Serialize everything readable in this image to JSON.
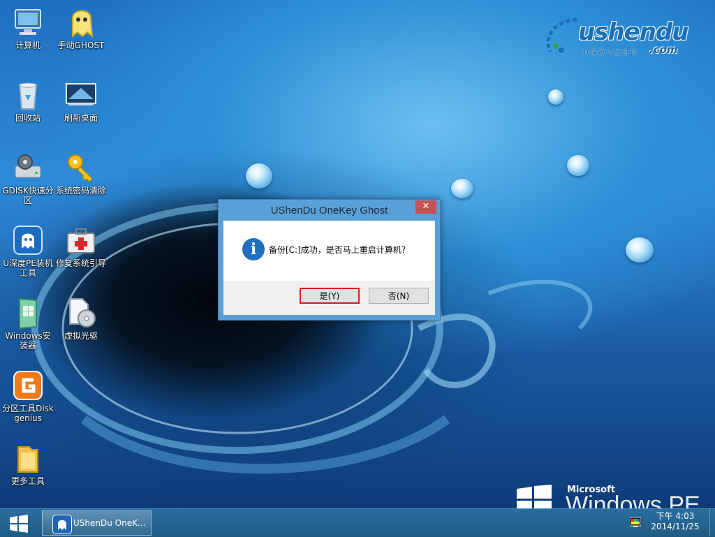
{
  "desktop": {
    "icons": [
      {
        "label": "计算机",
        "icon": "computer-icon"
      },
      {
        "label": "手动GHOST",
        "icon": "ghost-icon"
      },
      {
        "label": "回收站",
        "icon": "recycle-bin-icon"
      },
      {
        "label": "刷新桌面",
        "icon": "monitor-refresh-icon"
      },
      {
        "label": "GDISK快速分区",
        "icon": "disk-gear-icon"
      },
      {
        "label": "系统密码清除",
        "icon": "key-icon"
      },
      {
        "label": "U深度PE装机工具",
        "icon": "ushendu-ghost-icon"
      },
      {
        "label": "修复系统引导",
        "icon": "medical-kit-icon"
      },
      {
        "label": "Windows安装器",
        "icon": "windows-installer-icon"
      },
      {
        "label": "虚拟光驱",
        "icon": "virtual-drive-icon"
      },
      {
        "label": "分区工具Diskgenius",
        "icon": "diskgenius-icon"
      },
      {
        "label": "更多工具",
        "icon": "folder-icon"
      }
    ]
  },
  "logo": {
    "word": "ushendu",
    "tagline": "U深度U盘启动",
    "suffix": ".com"
  },
  "brand": {
    "company": "Microsoft",
    "product": "Windows PE"
  },
  "dialog": {
    "title": "UShenDu OneKey Ghost",
    "close_glyph": "✕",
    "message": "备份[C:]成功，是否马上重启计算机？",
    "info_glyph": "i",
    "yes_label": "是(Y)",
    "no_label": "否(N)"
  },
  "taskbar": {
    "item_label": "UShenDu OneK...",
    "clock_time": "下午 4:03",
    "clock_date": "2014/11/25"
  },
  "colors": {
    "accent": "#1f6fc0",
    "taskbar": "#205b86",
    "focus_border": "#d11f1f"
  }
}
